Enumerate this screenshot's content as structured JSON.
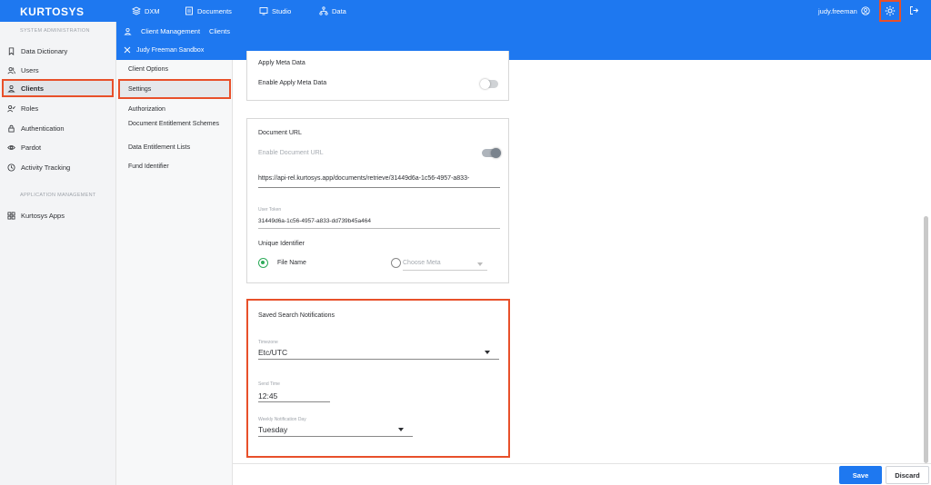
{
  "topbar": {
    "logo": "KURTOSYS",
    "nav": [
      {
        "label": "DXM",
        "icon": "layers-icon"
      },
      {
        "label": "Documents",
        "icon": "document-icon"
      },
      {
        "label": "Studio",
        "icon": "studio-icon"
      },
      {
        "label": "Data",
        "icon": "data-icon"
      }
    ],
    "username": "judy.freeman"
  },
  "sidebar": {
    "section1": "SYSTEM ADMINISTRATION",
    "items": [
      {
        "label": "Data Dictionary",
        "icon": "bookmark-icon"
      },
      {
        "label": "Users",
        "icon": "users-icon"
      },
      {
        "label": "Clients",
        "icon": "user-icon"
      },
      {
        "label": "Roles",
        "icon": "roles-icon"
      },
      {
        "label": "Authentication",
        "icon": "lock-icon"
      },
      {
        "label": "Pardot",
        "icon": "eye-icon"
      },
      {
        "label": "Activity Tracking",
        "icon": "clock-icon"
      }
    ],
    "section2": "APPLICATION MANAGEMENT",
    "apps": [
      {
        "label": "Kurtosys Apps",
        "icon": "grid-icon"
      }
    ]
  },
  "breadcrumb": {
    "parent": "Client Management",
    "current": "Clients"
  },
  "sandbox": {
    "label": "Judy Freeman Sandbox"
  },
  "subnav": [
    "Client Options",
    "Settings",
    "Authorization",
    "Document Entitlement Schemes",
    "Data Entitlement Lists",
    "Fund Identifier"
  ],
  "meta_card": {
    "title": "Apply Meta Data",
    "toggle_label": "Enable Apply Meta Data"
  },
  "doc_url_card": {
    "title": "Document URL",
    "toggle_label": "Enable Document URL",
    "url_value": "https://api-rel.kurtosys.app/documents/retrieve/31449d6a-1c56-4957-a833-",
    "token_label": "User Token",
    "token_value": "31449d6a-1c56-4957-a833-dd739b45a464",
    "unique_label": "Unique Identifier",
    "radio_file": "File Name",
    "radio_meta_placeholder": "Choose Meta"
  },
  "notifications_card": {
    "title": "Saved Search Notifications",
    "timezone_label": "Timezone",
    "timezone_value": "Etc/UTC",
    "send_time_label": "Send Time",
    "send_time_value": "12:45",
    "weekday_label": "Weekly Notification Day",
    "weekday_value": "Tuesday"
  },
  "footer": {
    "save": "Save",
    "discard": "Discard"
  },
  "colors": {
    "primary": "#1e78f0",
    "highlight": "#e8502a"
  }
}
